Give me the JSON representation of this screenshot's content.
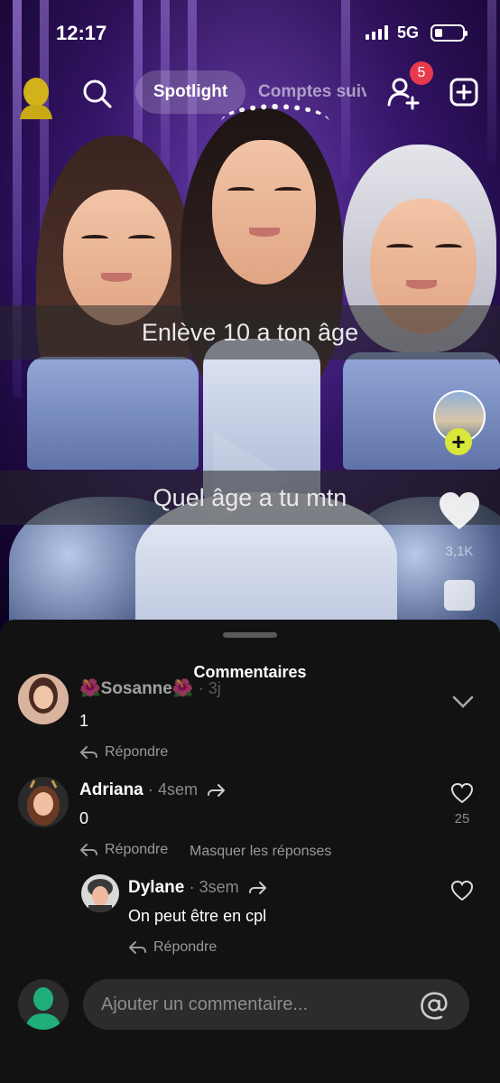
{
  "status_bar": {
    "time": "12:17",
    "network": "5G"
  },
  "header": {
    "tabs": [
      {
        "label": "Spotlight",
        "active": true
      },
      {
        "label": "Comptes suiv",
        "active": false
      }
    ],
    "add_friend_badge": "5",
    "icons": [
      "bitmoji-avatar-icon",
      "search-icon",
      "add-friend-icon",
      "create-plus-icon"
    ]
  },
  "video": {
    "overlay_texts": [
      "Enlève 10 a ton âge",
      "Quel âge a tu mtn"
    ],
    "like_count": "3,1K"
  },
  "comments_sheet": {
    "title": "Commentaires",
    "comments": [
      {
        "name": "🌺Sosanne🌺",
        "time": "· 3j",
        "text": "1",
        "reply_label": "Répondre"
      },
      {
        "name": "Adriana",
        "time": "· 4sem",
        "text": "0",
        "reply_label": "Répondre",
        "hide_replies_label": "Masquer les réponses",
        "likes": "25"
      },
      {
        "name": "Dylane",
        "time": "· 3sem",
        "text": "On peut être en cpl",
        "reply_label": "Répondre"
      }
    ],
    "input": {
      "placeholder": "Ajouter un commentaire..."
    }
  },
  "colors": {
    "sheet_bg": "#121212",
    "badge": "#e83a4a",
    "follow_plus": "#d9e63a",
    "me_avatar": "#1fae7a"
  }
}
